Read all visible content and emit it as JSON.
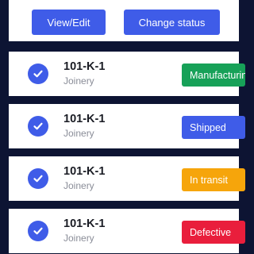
{
  "toolbar": {
    "view_edit_label": "View/Edit",
    "change_status_label": "Change status"
  },
  "orders": [
    {
      "code": "101-K-1",
      "department": "Joinery",
      "status": "Manufacturing",
      "status_color": "#17a158"
    },
    {
      "code": "101-K-1",
      "department": "Joinery",
      "status": "Shipped",
      "status_color": "#3f5ce8"
    },
    {
      "code": "101-K-1",
      "department": "Joinery",
      "status": "In transit",
      "status_color": "#f6a50b"
    },
    {
      "code": "101-K-1",
      "department": "Joinery",
      "status": "Defective",
      "status_color": "#e91e3c"
    }
  ],
  "colors": {
    "background": "#0d1433",
    "accent": "#3f5ce8"
  },
  "icons": {
    "row_check": "check-circle-icon"
  }
}
